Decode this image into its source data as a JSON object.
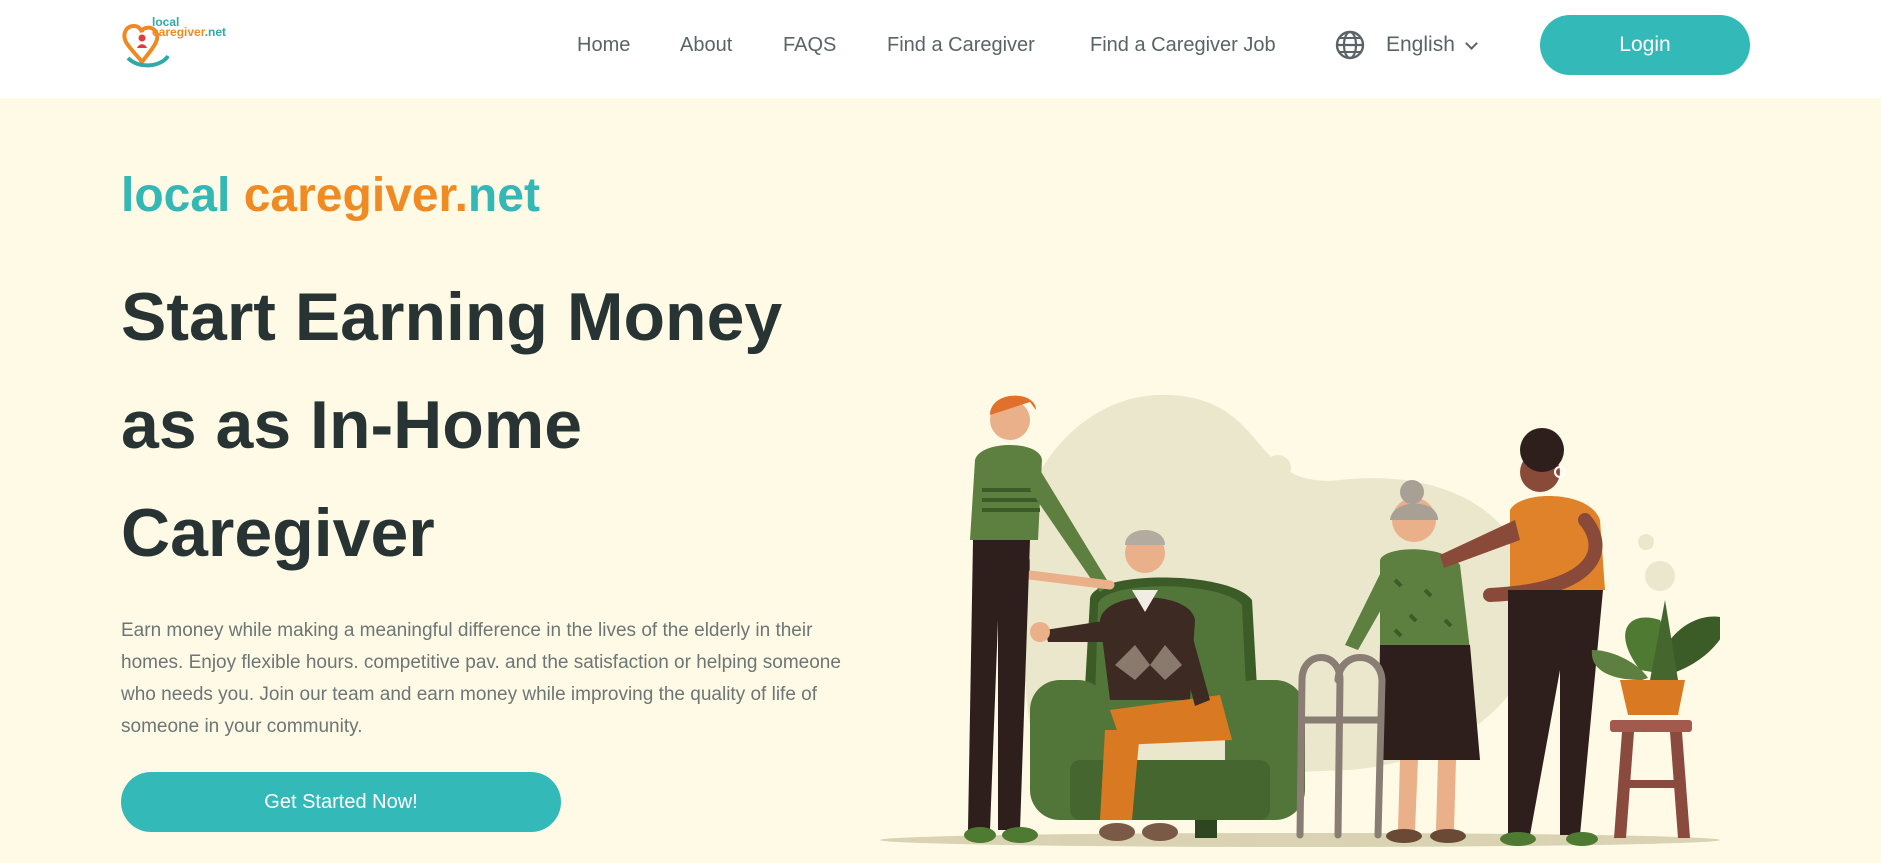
{
  "header": {
    "logo": {
      "line1": "local",
      "line2": "caregiver",
      "line2_suffix": ".net",
      "icon": "heart-pin-logo-icon"
    },
    "nav": [
      {
        "label": "Home"
      },
      {
        "label": "About"
      },
      {
        "label": "FAQS"
      },
      {
        "label": "Find a Caregiver"
      },
      {
        "label": "Find a Caregiver Job"
      }
    ],
    "language": {
      "icon": "globe-icon",
      "selected": "English",
      "chevron": "chevron-down-icon"
    },
    "login_label": "Login"
  },
  "hero": {
    "brand": {
      "part1": "local",
      "part2": "caregiver.",
      "part3": "net"
    },
    "headline": {
      "line1": "Start Earning Money",
      "line2": "as as In-Home",
      "line3": "Caregiver"
    },
    "description": "Earn money while making a meaningful difference in the lives of the elderly in their homes. Enjoy flexible hours. competitive pav. and the satisfaction or helping someone who needs you. Join our team and earn money while improving the quality of life of someone in your community.",
    "cta_label": "Get Started Now!"
  },
  "colors": {
    "accent": "#34b9b9",
    "brand_orange": "#f08a22",
    "hero_bg": "#fffae6",
    "headline": "#283434"
  }
}
